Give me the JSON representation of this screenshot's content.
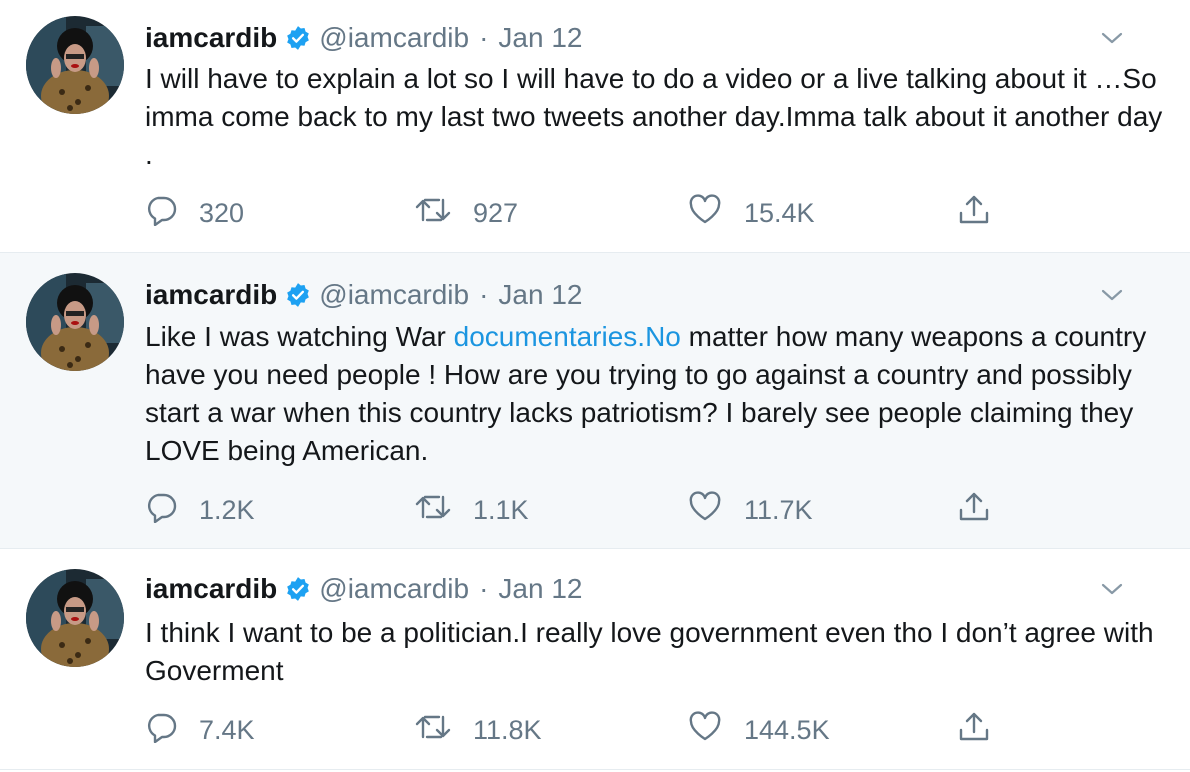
{
  "tweets": [
    {
      "name": "iamcardib",
      "handle": "@iamcardib",
      "separator": "·",
      "date": "Jan 12",
      "text_before": "I will have to explain a lot so I will have to do a video or a live talking about it …So imma come back to my last two tweets another day.Imma talk about it another day .",
      "link": "",
      "text_after": "",
      "replies": "320",
      "retweets": "927",
      "likes": "15.4K"
    },
    {
      "name": "iamcardib",
      "handle": "@iamcardib",
      "separator": "·",
      "date": "Jan 12",
      "text_before": "Like I was watching War ",
      "link": "documentaries.No",
      "text_after": " matter how many weapons a country have you need people ! How are you trying to go against a country and possibly start a war when this country lacks patriotism? I barely see people claiming they LOVE being American.",
      "replies": "1.2K",
      "retweets": "1.1K",
      "likes": "11.7K"
    },
    {
      "name": "iamcardib",
      "handle": "@iamcardib",
      "separator": "·",
      "date": "Jan 12",
      "text_before": "I think I want to be a politician.I really love government even tho I don’t agree with Goverment",
      "link": "",
      "text_after": "",
      "replies": "7.4K",
      "retweets": "11.8K",
      "likes": "144.5K"
    }
  ],
  "icons": {
    "verified": "verified-badge-icon",
    "caret": "chevron-down-icon",
    "reply": "reply-bubble-icon",
    "retweet": "retweet-icon",
    "like": "heart-icon",
    "share": "share-icon"
  },
  "colors": {
    "text": "#14171a",
    "muted": "#657786",
    "link": "#1b95e0",
    "verified": "#1da1f2",
    "highlight_bg": "#f5f8fa",
    "divider": "#e6ecf0"
  }
}
